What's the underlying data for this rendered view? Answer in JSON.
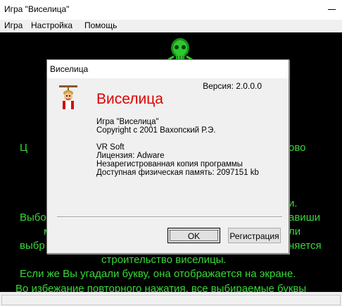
{
  "window": {
    "title": "Игра \"Виселица\""
  },
  "menu": [
    {
      "label": "Игра"
    },
    {
      "label": "Настройка"
    },
    {
      "label": "Помощь"
    }
  ],
  "background_text": {
    "line1_left": "Ц",
    "line1_right": "ово",
    "line2_left": "Выбо",
    "line2_right": "и.",
    "line3_left": "м",
    "line3_right": "авиши",
    "line4_left": "выбр",
    "line4_right": "ли",
    "line5_right": "няется",
    "line6": "строительство виселицы.",
    "line7": "Если же Вы угадали букву, она отображается на экране.",
    "line8": "Во избежание повторного нажатия, все выбираемые буквы"
  },
  "dialog": {
    "title": "Виселица",
    "version": "Версия: 2.0.0.0",
    "app_name": "Виселица",
    "game_name": "Игра \"Виселица\"",
    "copyright": "Copyright с 2001 Вахопский Р.Э.",
    "company": "VR Soft",
    "license": "Лицензия: Adware",
    "unregistered": "Незарегистрованная копия программы",
    "memory": "Доступная физическая память: 2097151 kb",
    "ok_label": "OK",
    "register_label": "Регистрация"
  },
  "colors": {
    "game_background": "#000000",
    "game_text": "#38d838",
    "app_name": "#e00000"
  }
}
